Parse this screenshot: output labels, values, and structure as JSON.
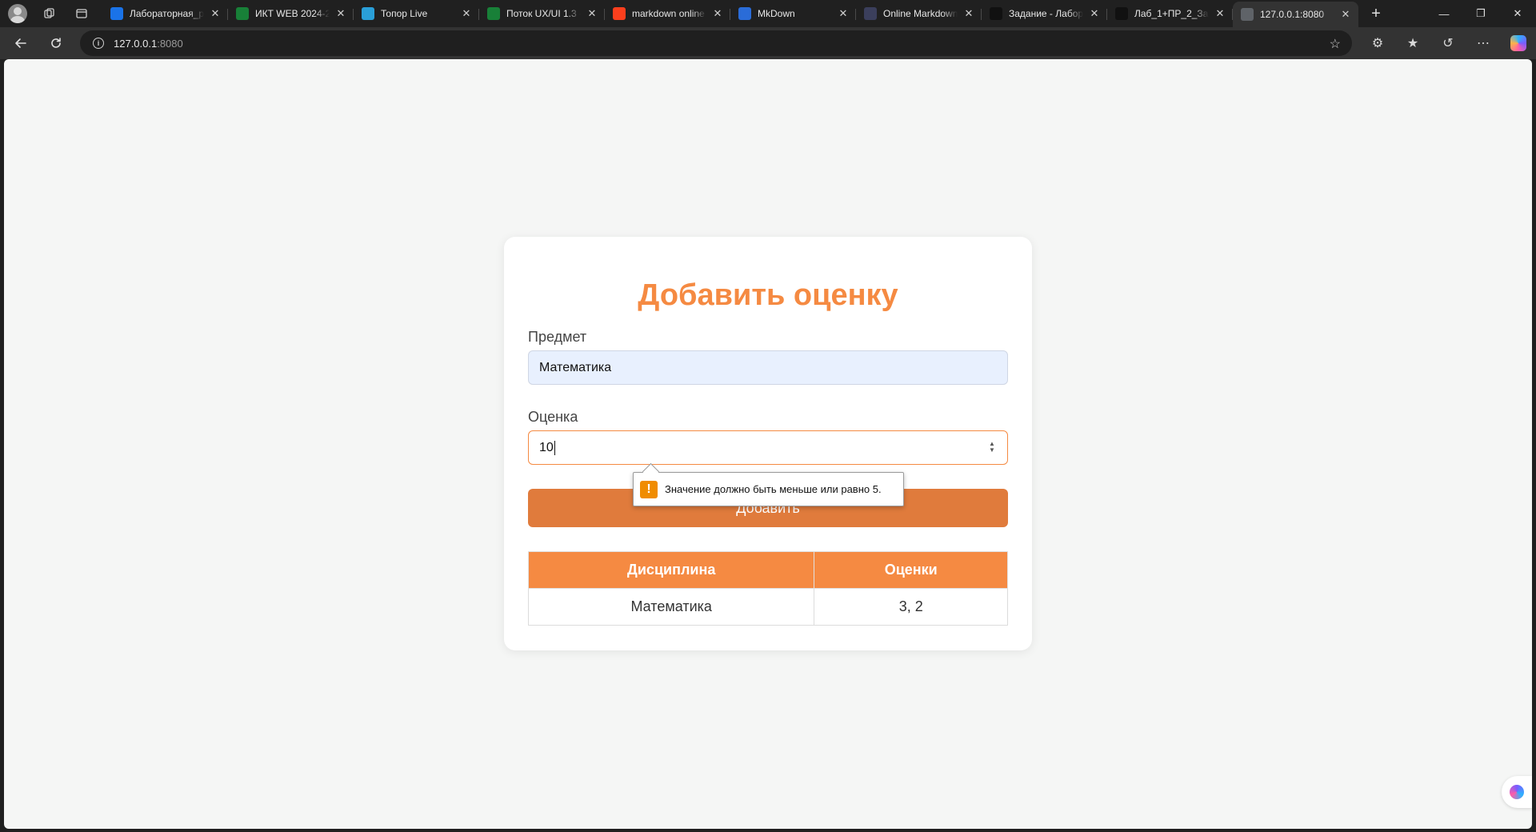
{
  "browser": {
    "tabs": [
      {
        "title": "Лабораторная_ра",
        "favicon": "google-drive-icon",
        "color": "#1a73e8"
      },
      {
        "title": "ИКТ WEB 2024-20",
        "favicon": "sheets-icon",
        "color": "#188038"
      },
      {
        "title": "Топор Live",
        "favicon": "telegram-icon",
        "color": "#2a9fd8"
      },
      {
        "title": "Поток UX/UI 1.3 -",
        "favicon": "sheets-icon",
        "color": "#188038"
      },
      {
        "title": "markdown online",
        "favicon": "yandex-icon",
        "color": "#fc3f1d"
      },
      {
        "title": "MkDown",
        "favicon": "chart-icon",
        "color": "#2a6cd8"
      },
      {
        "title": "Online Markdown",
        "favicon": "d-icon",
        "color": "#3b3f5c"
      },
      {
        "title": "Задание - Лабора",
        "favicon": "notion-icon",
        "color": "#111111"
      },
      {
        "title": "Лаб_1+ПР_2_Зад",
        "favicon": "github-icon",
        "color": "#111111"
      },
      {
        "title": "127.0.0.1:8080",
        "favicon": "globe-icon",
        "color": "#5f6368"
      }
    ],
    "url_host": "127.0.0.1",
    "url_port": ":8080"
  },
  "form": {
    "heading": "Добавить оценку",
    "subject_label": "Предмет",
    "subject_value": "Математика",
    "grade_label": "Оценка",
    "grade_value": "10",
    "submit_label": "Добавить",
    "validation_message": "Значение должно быть меньше или равно 5."
  },
  "table": {
    "headers": [
      "Дисциплина",
      "Оценки"
    ],
    "rows": [
      [
        "Математика",
        "3, 2"
      ]
    ]
  },
  "colors": {
    "accent": "#f58a42",
    "button": "#e07b3c"
  }
}
